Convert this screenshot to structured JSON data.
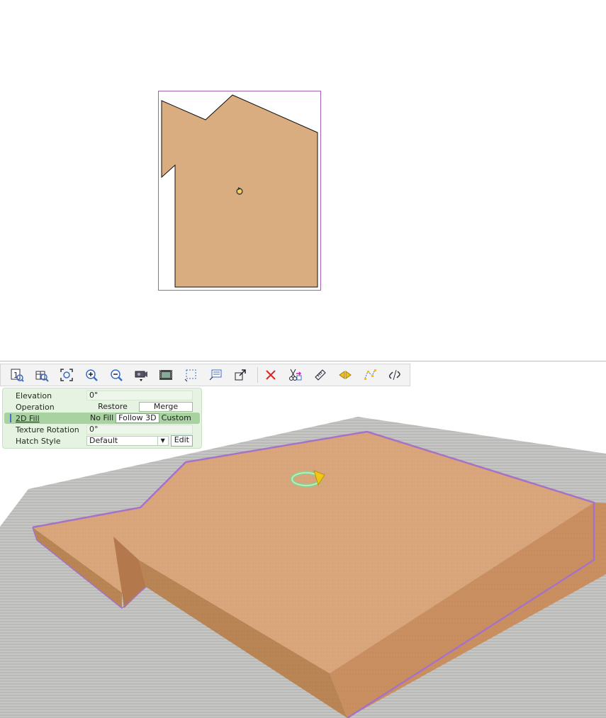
{
  "plan_view": {
    "region_fill": "#d9ad80",
    "selection_color": "#a45fb0"
  },
  "toolbar": {
    "items": [
      {
        "name": "zoom-1to1-icon"
      },
      {
        "name": "zoom-to-selection-icon"
      },
      {
        "name": "zoom-extents-icon"
      },
      {
        "name": "zoom-in-icon"
      },
      {
        "name": "zoom-out-icon"
      },
      {
        "name": "camera-icon"
      },
      {
        "name": "film-icon"
      },
      {
        "name": "select-region-icon"
      },
      {
        "name": "properties-icon"
      },
      {
        "name": "move-to-icon"
      },
      {
        "name": "delete-icon"
      },
      {
        "name": "cut-copy-icon"
      },
      {
        "name": "measure-icon"
      },
      {
        "name": "flip-icon"
      },
      {
        "name": "edit-points-icon"
      },
      {
        "name": "unlink-icon"
      }
    ]
  },
  "properties": {
    "elevation": {
      "label": "Elevation",
      "value": "0\""
    },
    "operation": {
      "label": "Operation",
      "options": [
        "Restore",
        "Merge"
      ],
      "selected": "Merge"
    },
    "fill_2d": {
      "label": "2D Fill",
      "options": [
        "No Fill",
        "Follow 3D",
        "Custom"
      ],
      "selected": "Follow 3D"
    },
    "texture_rotation": {
      "label": "Texture Rotation",
      "value": "0°"
    },
    "hatch_style": {
      "label": "Hatch Style",
      "value": "Default",
      "edit_label": "Edit"
    }
  },
  "colors": {
    "wood": "#d6a27a",
    "ground": "#bdbdbd",
    "selection": "#a572c6",
    "panel_bg": "#e6f3e2"
  }
}
